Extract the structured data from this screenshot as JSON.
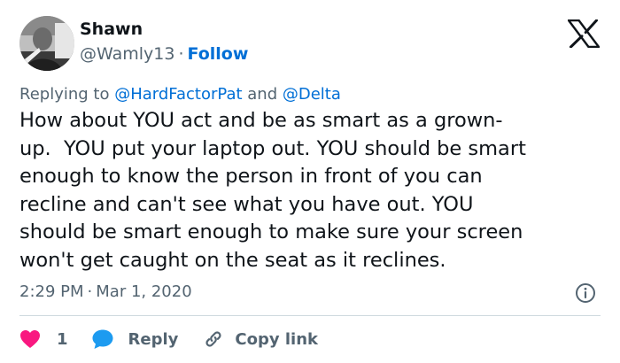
{
  "author": {
    "name": "Shawn",
    "handle": "@Wamly13",
    "separator": "·",
    "follow_label": "Follow"
  },
  "replying": {
    "prefix": "Replying to",
    "mention_1": "@HardFactorPat",
    "conjunction": "and",
    "mention_2": "@Delta"
  },
  "tweet": {
    "lines": [
      "How about YOU act and be as smart as a grown-",
      "up.  YOU put your laptop out. YOU should be smart",
      "enough to know the person in front of you can",
      "recline and can't see what you have out. YOU",
      "should be smart enough to make sure your screen",
      "won't get caught on the seat as it reclines."
    ],
    "time": "2:29 PM",
    "separator": "·",
    "date": "Mar 1, 2020"
  },
  "actions": {
    "like_count": "1",
    "reply_label": "Reply",
    "copy_label": "Copy link"
  },
  "icons": {
    "brand": "x-logo-icon",
    "info": "info-icon",
    "like": "heart-icon",
    "reply": "speech-bubble-icon",
    "copy": "link-icon"
  },
  "colors": {
    "text": "#0f1419",
    "secondary": "#536471",
    "link": "#006fd6",
    "like": "#f91880",
    "reply": "#1d9bf0",
    "divider": "#cfd9de"
  }
}
